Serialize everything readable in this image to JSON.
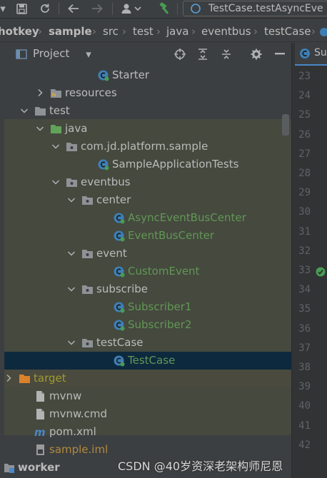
{
  "toolbar": {
    "run_config_label": "TestCase.testAsyncEve",
    "icons": [
      "save-icon",
      "sync-icon",
      "back-icon",
      "forward-icon",
      "user-dropdown-icon",
      "build-hammer-icon"
    ]
  },
  "breadcrumb": {
    "items": [
      "hotkey",
      "sample",
      "src",
      "test",
      "java",
      "eventbus",
      "testCase"
    ]
  },
  "project_pane": {
    "title": "Project"
  },
  "tree": [
    {
      "label": "Starter",
      "indent": 7,
      "icon": "class",
      "color": "normal"
    },
    {
      "label": "resources",
      "indent": 4,
      "toggle": "collapsed",
      "icon": "folder-res",
      "color": "normal"
    },
    {
      "label": "test",
      "indent": 3,
      "toggle": "expanded",
      "icon": "folder-gray",
      "color": "normal"
    },
    {
      "label": "java",
      "indent": 4,
      "toggle": "expanded",
      "icon": "folder-green",
      "color": "normal"
    },
    {
      "label": "com.jd.platform.sample",
      "indent": 5,
      "toggle": "expanded",
      "icon": "package",
      "color": "normal"
    },
    {
      "label": "SampleApplicationTests",
      "indent": 7,
      "icon": "class",
      "color": "normal"
    },
    {
      "label": "eventbus",
      "indent": 5,
      "toggle": "expanded",
      "icon": "package",
      "color": "normal"
    },
    {
      "label": "center",
      "indent": 6,
      "toggle": "expanded",
      "icon": "package",
      "color": "normal"
    },
    {
      "label": "AsyncEventBusCenter",
      "indent": 8,
      "icon": "class",
      "color": "green"
    },
    {
      "label": "EventBusCenter",
      "indent": 8,
      "icon": "class",
      "color": "green"
    },
    {
      "label": "event",
      "indent": 6,
      "toggle": "expanded",
      "icon": "package",
      "color": "normal"
    },
    {
      "label": "CustomEvent",
      "indent": 8,
      "icon": "class",
      "color": "green"
    },
    {
      "label": "subscribe",
      "indent": 6,
      "toggle": "expanded",
      "icon": "package",
      "color": "normal"
    },
    {
      "label": "Subscriber1",
      "indent": 8,
      "icon": "class",
      "color": "green"
    },
    {
      "label": "Subscriber2",
      "indent": 8,
      "icon": "class",
      "color": "green"
    },
    {
      "label": "testCase",
      "indent": 6,
      "toggle": "expanded",
      "icon": "package",
      "color": "normal"
    },
    {
      "label": "TestCase",
      "indent": 8,
      "icon": "class",
      "color": "green",
      "selected": true
    },
    {
      "label": "target",
      "indent": 2,
      "toggle": "collapsed",
      "icon": "folder-orange",
      "color": "olive"
    },
    {
      "label": "mvnw",
      "indent": 3,
      "icon": "file",
      "color": "normal"
    },
    {
      "label": "mvnw.cmd",
      "indent": 3,
      "icon": "file",
      "color": "normal"
    },
    {
      "label": "pom.xml",
      "indent": 3,
      "icon": "maven",
      "color": "normal"
    },
    {
      "label": "sample.iml",
      "indent": 3,
      "icon": "iml",
      "color": "brown"
    },
    {
      "label": "worker",
      "indent": 1,
      "toggle": "expanded",
      "icon": "folder-module",
      "color": "normal",
      "bold": true
    }
  ],
  "editor": {
    "tab_label": "Su",
    "line_numbers": [
      "23",
      "24",
      "25",
      "26",
      "27",
      "28",
      "29",
      "30",
      "31",
      "32",
      "33",
      "34",
      "35",
      "36",
      "37",
      "38",
      "39",
      "40",
      "41",
      "42"
    ]
  },
  "watermark": "CSDN @40岁资深老架构师尼恩",
  "colors": {
    "background": "#3c3f41",
    "selected_row": "#0d293e",
    "test_scope_band": "#45493e",
    "green_class": "#629755",
    "target_olive": "#a19b2e",
    "gutter": "#313335"
  }
}
